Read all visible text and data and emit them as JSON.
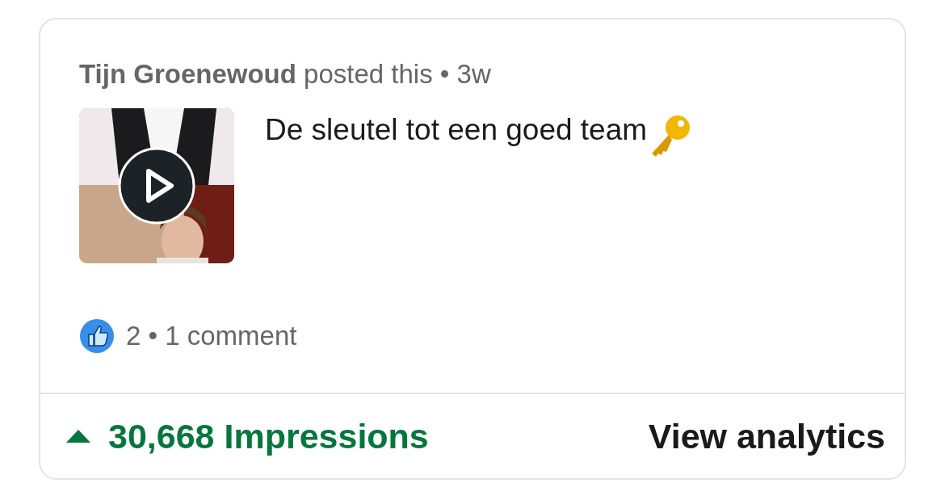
{
  "post": {
    "header": "**Tijn Groenewoud** posted this • 3w",
    "media": {
      "kind": "picture",
      "video": true
    },
    "text": "De sleutel tot een goed team",
    "reactions": "2 • 1 comment"
  },
  "footer": {
    "trending_up": true,
    "impressions": "30,668 Impressions",
    "link": "View analytics"
  }
}
